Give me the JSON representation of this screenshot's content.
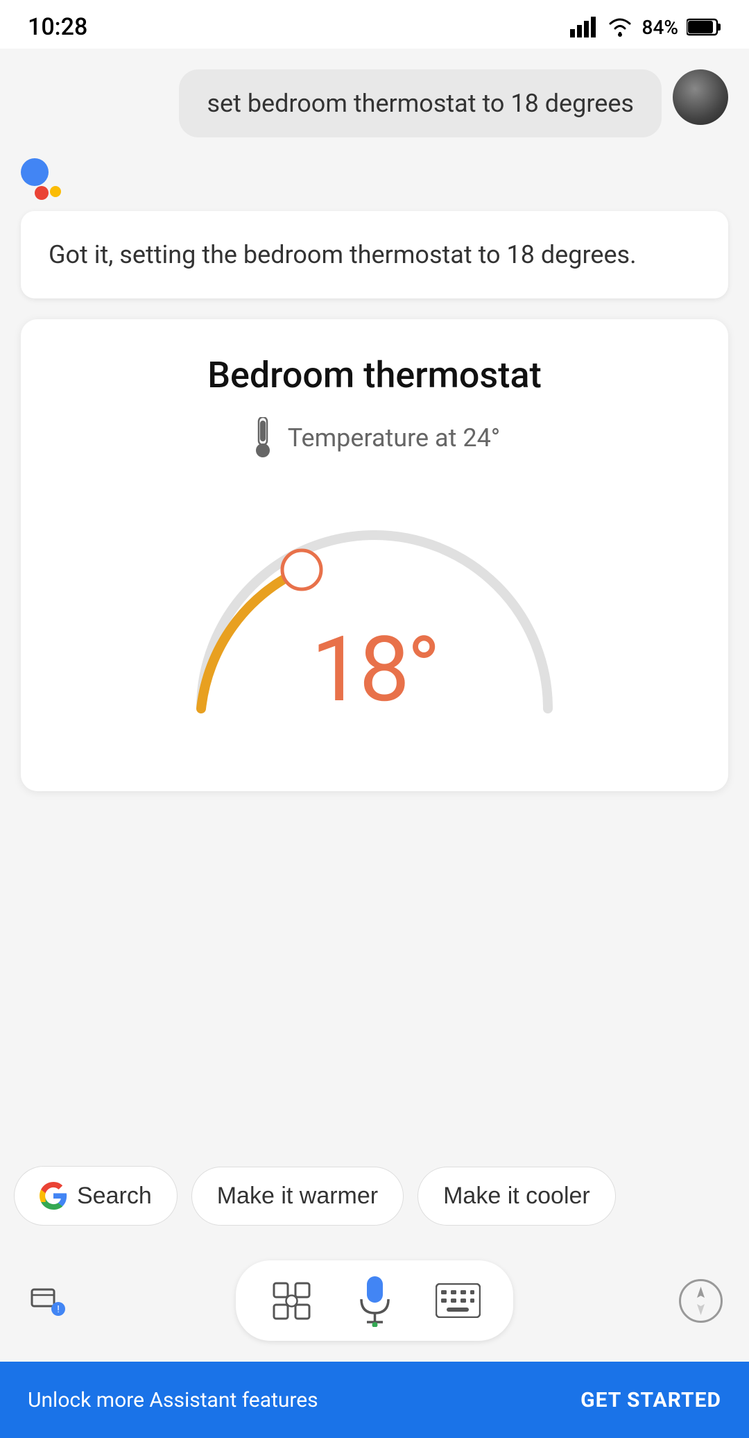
{
  "statusBar": {
    "time": "10:28",
    "battery": "84%",
    "signalUnicode": "▂▄▆█",
    "wifiUnicode": "WiFi"
  },
  "userMessage": {
    "text": "set bedroom thermostat to 18 degrees"
  },
  "assistantMessage": {
    "text": "Got it, setting the bedroom thermostat to 18 degrees."
  },
  "thermostatCard": {
    "title": "Bedroom thermostat",
    "temperatureLabel": "Temperature at 24°",
    "setTemperature": "18°",
    "currentTemp": 24,
    "setTemp": 18,
    "minTemp": 10,
    "maxTemp": 32
  },
  "actionButtons": [
    {
      "label": "Search",
      "hasGoogleLogo": true
    },
    {
      "label": "Make it warmer",
      "hasGoogleLogo": false
    },
    {
      "label": "Make it cooler",
      "hasGoogleLogo": false
    }
  ],
  "unlockBar": {
    "text": "Unlock more Assistant features",
    "buttonLabel": "GET STARTED"
  }
}
